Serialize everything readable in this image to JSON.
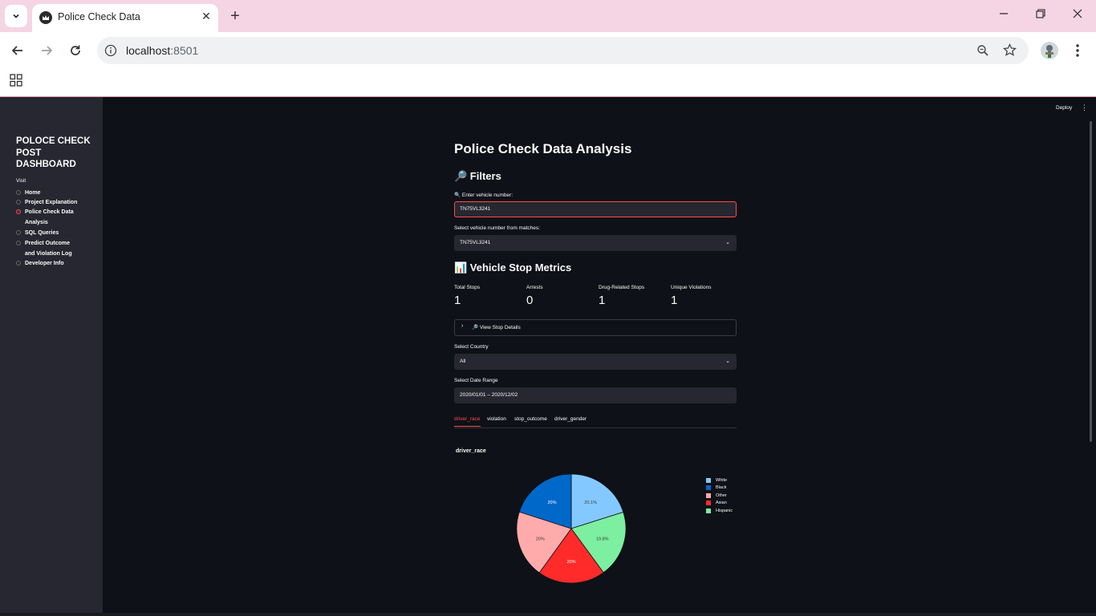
{
  "browser": {
    "tab_title": "Police Check Data",
    "url_host": "localhost",
    "url_port": ":8501"
  },
  "sidebar": {
    "title": "POLOCE CHECK POST DASHBOARD",
    "visit_label": "Visit",
    "items": [
      {
        "label": "Home",
        "selected": false
      },
      {
        "label": "Project Explanation",
        "selected": false
      },
      {
        "label": "Police Check Data Analysis",
        "selected": true
      },
      {
        "label": "SQL Queries",
        "selected": false
      },
      {
        "label": "Predict Outcome and Violation Log",
        "selected": false
      },
      {
        "label": "Developer Info",
        "selected": false
      }
    ]
  },
  "header": {
    "deploy_label": "Deploy"
  },
  "main": {
    "title": "Police Check Data Analysis",
    "filters_heading": "🔎 Filters",
    "vehicle_input_label": "🔍 Enter vehicle number:",
    "vehicle_input_value": "TN75VL3241",
    "vehicle_select_label": "Select vehicle number from matches:",
    "vehicle_select_value": "TN75VL3241",
    "metrics_heading": "📊 Vehicle Stop Metrics",
    "metrics": [
      {
        "label": "Total Stops",
        "value": "1"
      },
      {
        "label": "Arrests",
        "value": "0"
      },
      {
        "label": "Drug-Related Stops",
        "value": "1"
      },
      {
        "label": "Unique Violations",
        "value": "1"
      }
    ],
    "expander_label": "🔎 View Stop Details",
    "country_label": "Select Country",
    "country_value": "All",
    "date_label": "Select Date Range",
    "date_value": "2020/01/01 – 2020/12/02",
    "tabs": [
      "driver_race",
      "violation",
      "stop_outcome",
      "driver_gender"
    ],
    "active_tab": 0
  },
  "chart_data": {
    "type": "pie",
    "title": "driver_race",
    "slices": [
      {
        "label": "White",
        "value": 20.1,
        "text": "20.1%",
        "color": "#83c9ff"
      },
      {
        "label": "Hispanic",
        "value": 19.8,
        "text": "19.8%",
        "color": "#7defa1"
      },
      {
        "label": "Asian",
        "value": 20,
        "text": "20%",
        "color": "#ff2b2b"
      },
      {
        "label": "Other",
        "value": 20,
        "text": "20%",
        "color": "#ffabab"
      },
      {
        "label": "Black",
        "value": 20,
        "text": "20%",
        "color": "#0068c9"
      }
    ],
    "legend": [
      "White",
      "Black",
      "Other",
      "Asian",
      "Hispanic"
    ],
    "legend_colors": [
      "#83c9ff",
      "#0068c9",
      "#ffabab",
      "#ff2b2b",
      "#7defa1"
    ],
    "legend_position": "right"
  }
}
